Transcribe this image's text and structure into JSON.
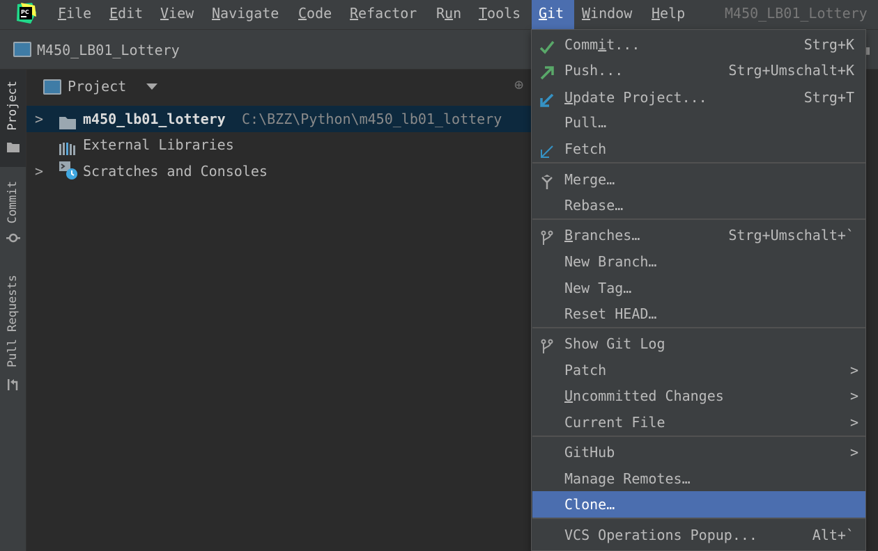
{
  "menubar": {
    "items": [
      {
        "pre": "",
        "mn": "F",
        "post": "ile"
      },
      {
        "pre": "",
        "mn": "E",
        "post": "dit"
      },
      {
        "pre": "",
        "mn": "V",
        "post": "iew"
      },
      {
        "pre": "",
        "mn": "N",
        "post": "avigate"
      },
      {
        "pre": "",
        "mn": "C",
        "post": "ode"
      },
      {
        "pre": "",
        "mn": "R",
        "post": "efactor"
      },
      {
        "pre": "R",
        "mn": "u",
        "post": "n"
      },
      {
        "pre": "",
        "mn": "T",
        "post": "ools"
      },
      {
        "pre": "",
        "mn": "G",
        "post": "it"
      },
      {
        "pre": "",
        "mn": "W",
        "post": "indow"
      },
      {
        "pre": "",
        "mn": "H",
        "post": "elp"
      }
    ],
    "window_title": "M450_LB01_Lottery"
  },
  "navbar": {
    "title": "M450_LB01_Lottery"
  },
  "toolstrip": {
    "tabs": [
      "Project",
      "Commit",
      "Pull Requests"
    ]
  },
  "project": {
    "header": "Project",
    "rows": [
      {
        "label": "m450_lb01_lottery",
        "path": "C:\\BZZ\\Python\\m450_lb01_lottery"
      },
      {
        "label": "External Libraries"
      },
      {
        "label": "Scratches and Consoles"
      }
    ]
  },
  "git_menu": {
    "items": [
      {
        "pre": "Comm",
        "mn": "i",
        "post": "t...",
        "shortcut": "Strg+K",
        "icon": "checkmark-icon"
      },
      {
        "pre": "",
        "mn": "",
        "post": "Push...",
        "shortcut": "Strg+Umschalt+K",
        "icon": "push-arrow-icon"
      },
      {
        "pre": "",
        "mn": "U",
        "post": "pdate Project...",
        "shortcut": "Strg+T",
        "icon": "update-arrow-icon"
      },
      {
        "pre": "",
        "mn": "",
        "post": "Pull…",
        "shortcut": "",
        "icon": ""
      },
      {
        "pre": "",
        "mn": "",
        "post": "Fetch",
        "shortcut": "",
        "icon": "fetch-arrow-icon"
      },
      {
        "pre": "",
        "mn": "",
        "post": "Merge…",
        "shortcut": "",
        "icon": "merge-icon"
      },
      {
        "pre": "",
        "mn": "",
        "post": "Rebase…",
        "shortcut": "",
        "icon": ""
      },
      {
        "pre": "",
        "mn": "B",
        "post": "ranches…",
        "shortcut": "Strg+Umschalt+`",
        "icon": "branch-icon"
      },
      {
        "pre": "",
        "mn": "",
        "post": "New Branch…",
        "shortcut": "",
        "icon": ""
      },
      {
        "pre": "",
        "mn": "",
        "post": "New Tag…",
        "shortcut": "",
        "icon": ""
      },
      {
        "pre": "",
        "mn": "",
        "post": "Reset HEAD…",
        "shortcut": "",
        "icon": ""
      },
      {
        "pre": "",
        "mn": "",
        "post": "Show Git Log",
        "shortcut": "",
        "icon": "git-log-icon"
      },
      {
        "pre": "",
        "mn": "",
        "post": "Patch",
        "shortcut": "",
        "icon": ""
      },
      {
        "pre": "",
        "mn": "U",
        "post": "ncommitted Changes",
        "shortcut": "",
        "icon": ""
      },
      {
        "pre": "",
        "mn": "",
        "post": "Current File",
        "shortcut": "",
        "icon": ""
      },
      {
        "pre": "",
        "mn": "",
        "post": "GitHub",
        "shortcut": "",
        "icon": ""
      },
      {
        "pre": "",
        "mn": "",
        "post": "Manage Remotes…",
        "shortcut": "",
        "icon": ""
      },
      {
        "pre": "",
        "mn": "",
        "post": "Clone…",
        "shortcut": "",
        "icon": ""
      },
      {
        "pre": "",
        "mn": "",
        "post": "VCS Operations Popup...",
        "shortcut": "Alt+`",
        "icon": ""
      }
    ]
  },
  "colors": {
    "accent": "#4b6eaf",
    "selection": "#0d293e",
    "background": "#2b2b2b",
    "panel": "#3c3f41"
  }
}
